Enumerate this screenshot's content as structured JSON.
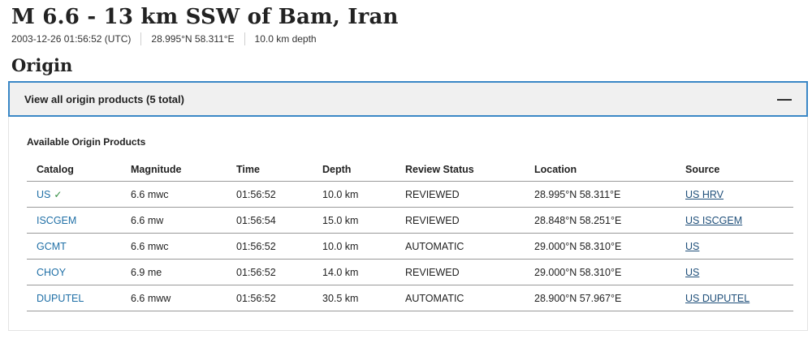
{
  "event": {
    "title": "M 6.6 - 13 km SSW of Bam, Iran",
    "time": "2003-12-26 01:56:52 (UTC)",
    "coords": "28.995°N 58.311°E",
    "depth": "10.0 km depth"
  },
  "origin": {
    "section_title": "Origin",
    "accordion_label": "View all origin products (5 total)",
    "toggle_symbol": "—",
    "subheading": "Available Origin Products",
    "columns": [
      "Catalog",
      "Magnitude",
      "Time",
      "Depth",
      "Review Status",
      "Location",
      "Source"
    ],
    "rows": [
      {
        "catalog": "US",
        "preferred": true,
        "check_symbol": "✓",
        "magnitude": "6.6 mwc",
        "time": "01:56:52",
        "depth": "10.0 km",
        "status": "REVIEWED",
        "location": "28.995°N 58.311°E",
        "source": "US HRV"
      },
      {
        "catalog": "ISCGEM",
        "preferred": false,
        "check_symbol": "",
        "magnitude": "6.6 mw",
        "time": "01:56:54",
        "depth": "15.0 km",
        "status": "REVIEWED",
        "location": "28.848°N 58.251°E",
        "source": "US ISCGEM"
      },
      {
        "catalog": "GCMT",
        "preferred": false,
        "check_symbol": "",
        "magnitude": "6.6 mwc",
        "time": "01:56:52",
        "depth": "10.0 km",
        "status": "AUTOMATIC",
        "location": "29.000°N 58.310°E",
        "source": "US"
      },
      {
        "catalog": "CHOY",
        "preferred": false,
        "check_symbol": "",
        "magnitude": "6.9 me",
        "time": "01:56:52",
        "depth": "14.0 km",
        "status": "REVIEWED",
        "location": "29.000°N 58.310°E",
        "source": "US"
      },
      {
        "catalog": "DUPUTEL",
        "preferred": false,
        "check_symbol": "",
        "magnitude": "6.6 mww",
        "time": "01:56:52",
        "depth": "30.5 km",
        "status": "AUTOMATIC",
        "location": "28.900°N 57.967°E",
        "source": "US DUPUTEL"
      }
    ]
  },
  "colors": {
    "accent_border": "#3a87c6",
    "link": "#1f6fa6",
    "check": "#2e8b3e"
  }
}
